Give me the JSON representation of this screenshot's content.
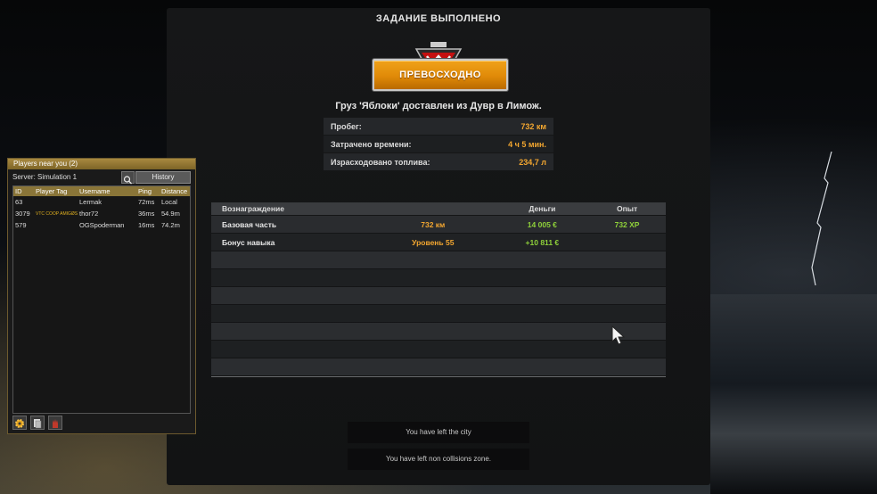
{
  "job_result": {
    "title": "ЗАДАНИЕ ВЫПОЛНЕНО",
    "rating": "ПРЕВОСХОДНО",
    "cargo_line": "Груз 'Яблоки' доставлен из Дувр в Лимож.",
    "stats": [
      {
        "label": "Пробег:",
        "value": "732 км"
      },
      {
        "label": "Затрачено времени:",
        "value": "4 ч 5 мин."
      },
      {
        "label": "Израсходовано топлива:",
        "value": "234,7 л"
      }
    ],
    "rewards": {
      "headers": {
        "reward": "Вознаграждение",
        "detail": "",
        "money": "Деньги",
        "xp": "Опыт"
      },
      "rows": [
        {
          "reward": "Базовая часть",
          "detail": "732 км",
          "money": "14 005 €",
          "xp": "732 XP"
        },
        {
          "reward": "Бонус навыка",
          "detail": "Уровень 55",
          "money": "+10 811 €",
          "xp": ""
        }
      ]
    }
  },
  "notifications": [
    "You have left the city",
    "You have left non collisions zone."
  ],
  "players_panel": {
    "title": "Players near you (2)",
    "server": "Server: Simulation 1",
    "history_label": "History",
    "columns": [
      "ID",
      "Player Tag",
      "Username",
      "Ping",
      "Distance"
    ],
    "rows": [
      {
        "id": "63",
        "tag": "",
        "username": "Lermak",
        "ping": "72ms",
        "distance": "Local"
      },
      {
        "id": "3079",
        "tag": "VTC COOP AMIGØS |",
        "username": "thor72",
        "ping": "36ms",
        "distance": "54.9m"
      },
      {
        "id": "579",
        "tag": "",
        "username": "OGSpoderman",
        "ping": "16ms",
        "distance": "74.2m"
      }
    ]
  },
  "colors": {
    "accent_orange": "#f2a630",
    "money_green": "#8fd13a",
    "panel_gold": "#a8893f"
  }
}
